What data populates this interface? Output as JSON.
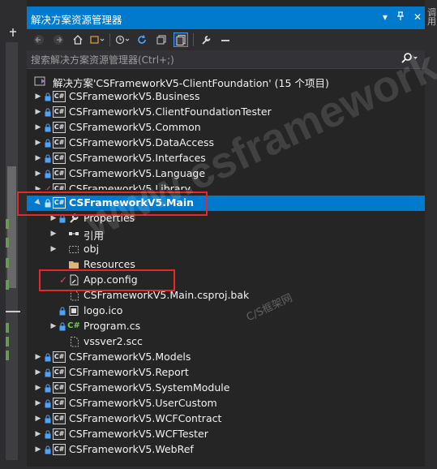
{
  "window": {
    "title": "解决方案资源管理器",
    "right_edge_text": "调用",
    "title_buttons": [
      "▾",
      "⊓",
      "✕"
    ]
  },
  "toolbar": {
    "icons": [
      "back-icon",
      "forward-icon",
      "home-icon",
      "switch-views-icon",
      "history-icon",
      "sync-icon",
      "collapse-all-icon",
      "show-all-files-icon",
      "properties-icon",
      "preview-icon"
    ]
  },
  "search": {
    "placeholder": "搜索解决方案资源管理器(Ctrl+;)"
  },
  "tree": {
    "solution": "解决方案'CSFrameworkV5-ClientFoundation' (15 个项目)",
    "items": [
      {
        "label": "CSFrameworkV5.Business",
        "type": "project"
      },
      {
        "label": "CSFrameworkV5.ClientFoundationTester",
        "type": "project"
      },
      {
        "label": "CSFrameworkV5.Common",
        "type": "project"
      },
      {
        "label": "CSFrameworkV5.DataAccess",
        "type": "project"
      },
      {
        "label": "CSFrameworkV5.Interfaces",
        "type": "project"
      },
      {
        "label": "CSFrameworkV5.Language",
        "type": "project"
      },
      {
        "label": "CSFrameworkV5.Library",
        "type": "project"
      },
      {
        "label": "CSFrameworkV5.Main",
        "type": "project",
        "selected": true
      },
      {
        "label": "Properties",
        "type": "folder"
      },
      {
        "label": "引用",
        "type": "references"
      },
      {
        "label": "obj",
        "type": "folder"
      },
      {
        "label": "Resources",
        "type": "folder"
      },
      {
        "label": "App.config",
        "type": "file"
      },
      {
        "label": "CSFrameworkV5.Main.csproj.bak",
        "type": "file"
      },
      {
        "label": "logo.ico",
        "type": "file"
      },
      {
        "label": "Program.cs",
        "type": "file"
      },
      {
        "label": "vssver2.scc",
        "type": "file"
      },
      {
        "label": "CSFrameworkV5.Models",
        "type": "project"
      },
      {
        "label": "CSFrameworkV5.Report",
        "type": "project"
      },
      {
        "label": "CSFrameworkV5.SystemModule",
        "type": "project"
      },
      {
        "label": "CSFrameworkV5.UserCustom",
        "type": "project"
      },
      {
        "label": "CSFrameworkV5.WCFContract",
        "type": "project"
      },
      {
        "label": "CSFrameworkV5.WCFTester",
        "type": "project"
      },
      {
        "label": "CSFrameworkV5.WebRef",
        "type": "project"
      }
    ]
  },
  "watermark": {
    "main": "www.csframework.com",
    "sub": "C/S框架网"
  },
  "colors": {
    "accent": "#007acc",
    "highlight_box": "#e8262b",
    "background": "#252526"
  }
}
